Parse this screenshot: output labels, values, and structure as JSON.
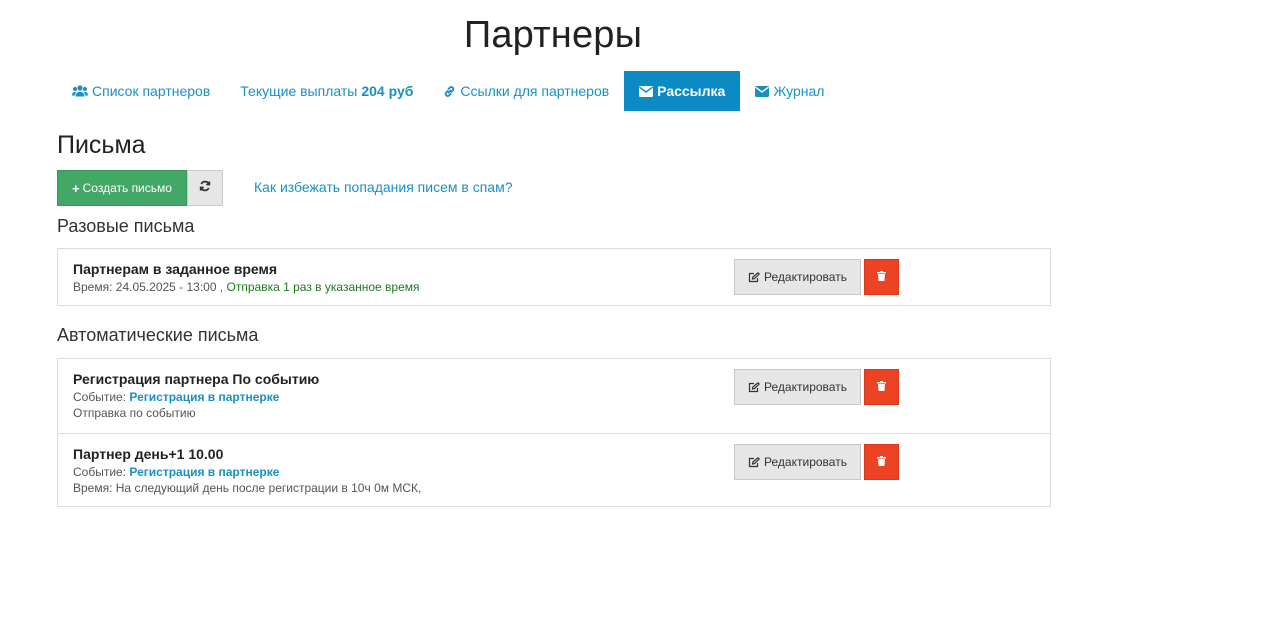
{
  "page": {
    "title": "Партнеры"
  },
  "tabs": [
    {
      "label": "Список партнеров",
      "icon": "users-icon",
      "active": false
    },
    {
      "label": "Текущие выплаты",
      "bold_value": "204 руб",
      "active": false
    },
    {
      "label": "Ссылки для партнеров",
      "icon": "link-icon",
      "active": false
    },
    {
      "label": "Рассылка",
      "icon": "envelope-icon",
      "active": true
    },
    {
      "label": "Журнал",
      "icon": "envelope-icon",
      "active": false
    }
  ],
  "letters": {
    "heading": "Письма",
    "create_button": {
      "plus": "+",
      "label": "Создать письмо"
    },
    "refresh_icon": "refresh-icon",
    "spam_link": "Как избежать попадания писем в спам?"
  },
  "one_time": {
    "heading": "Разовые письма",
    "items": [
      {
        "title": "Партнерам в заданное время",
        "time_label": "Время:",
        "time_value": "24.05.2025 - 13:00 ,",
        "status": "Отправка 1 раз в указанное время"
      }
    ]
  },
  "automatic": {
    "heading": "Автоматические письма",
    "items": [
      {
        "title": "Регистрация партнера По событию",
        "event_label": "Событие:",
        "event_value": "Регистрация в партнерке",
        "line2": "Отправка по событию"
      },
      {
        "title": "Партнер день+1 10.00",
        "event_label": "Событие:",
        "event_value": "Регистрация в партнерке",
        "line2": "Время: На следующий день после регистрации в 10ч 0м МСК,"
      }
    ]
  },
  "buttons": {
    "edit_label": "Редактировать",
    "edit_icon": "edit-icon",
    "delete_icon": "trash-icon"
  },
  "colors": {
    "accent": "#0b8ac4",
    "link": "#1a8fc2",
    "create": "#43a866",
    "delete": "#ec4324",
    "success_text": "#1f7a1f"
  }
}
